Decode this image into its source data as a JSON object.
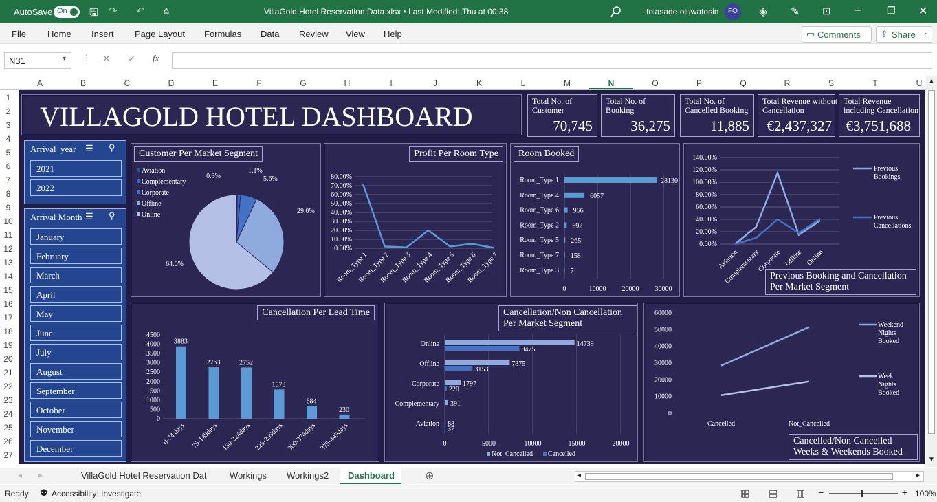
{
  "titlebar": {
    "autosave": "AutoSave",
    "toggle": "On",
    "filename": "VillaGold Hotel Reservation Data.xlsx  •  Last Modified: Thu at 00:38",
    "user": "folasade oluwatosin",
    "initials": "FO"
  },
  "menu": [
    "File",
    "Home",
    "Insert",
    "Page Layout",
    "Formulas",
    "Data",
    "Review",
    "View",
    "Help"
  ],
  "buttons": {
    "comments": "Comments",
    "share": "Share"
  },
  "formula": {
    "namebox": "N31",
    "fx": "fx",
    "value": ""
  },
  "columns": [
    "A",
    "B",
    "C",
    "D",
    "E",
    "F",
    "G",
    "H",
    "I",
    "J",
    "K",
    "L",
    "M",
    "N",
    "O",
    "P",
    "Q",
    "R",
    "S",
    "T",
    "U"
  ],
  "rows": [
    "1",
    "2",
    "3",
    "4",
    "5",
    "6",
    "7",
    "8",
    "9",
    "10",
    "11",
    "12",
    "13",
    "14",
    "15",
    "16",
    "17",
    "18",
    "19",
    "20",
    "21",
    "22",
    "23",
    "24",
    "25",
    "26",
    "27"
  ],
  "dashboard": {
    "title": "VILLAGOLD HOTEL DASHBOARD",
    "kpis": [
      {
        "label": "Total No. of Customer",
        "value": "70,745"
      },
      {
        "label": "Total No. of Booking",
        "value": "36,275"
      },
      {
        "label": "Total No. of Cancelled Booking",
        "value": "11,885"
      },
      {
        "label": "Total Revenue without Cancellation",
        "value": "€2,437,327"
      },
      {
        "label": "Total Revenue including Cancellation",
        "value": "€3,751,688"
      }
    ],
    "slicers": {
      "year": {
        "title": "Arrival_year",
        "items": [
          "2021",
          "2022"
        ]
      },
      "month": {
        "title": "Arrival Month",
        "items": [
          "January",
          "February",
          "March",
          "April",
          "May",
          "June",
          "July",
          "August",
          "September",
          "October",
          "November",
          "December"
        ]
      }
    },
    "panels": {
      "pie": "Customer Per Market Segment",
      "profit": "Profit Per Room Type",
      "rooms": "Room Booked",
      "prev": "Previous Booking and Cancellation Per Market Segment",
      "lead": "Cancellation Per Lead Time",
      "cancelseg": "Cancellation/Non Cancellation Per Market Segment",
      "weeks": "Cancelled/Non Cancelled Weeks & Weekends Booked"
    }
  },
  "chart_data": [
    {
      "type": "pie",
      "title": "Customer Per Market Segment",
      "categories": [
        "Aviation",
        "Complementary",
        "Corporate",
        "Offline",
        "Online"
      ],
      "values": [
        0.3,
        1.1,
        5.6,
        29.0,
        64.0
      ],
      "labels": [
        "0.3%",
        "1.1%",
        "5.6%",
        "29.0%",
        "64.0%"
      ],
      "colors": [
        "#2f5597",
        "#3a64c8",
        "#4472c4",
        "#8faadc",
        "#b4c0e6"
      ]
    },
    {
      "type": "line",
      "title": "Profit Per Room Type",
      "categories": [
        "Room_Type 1",
        "Room_Type 2",
        "Room_Type 3",
        "Room_Type 4",
        "Room_Type 5",
        "Room_Type 6",
        "Room_Type 7"
      ],
      "values": [
        72,
        2,
        1,
        20,
        2,
        5,
        0.5
      ],
      "yticks": [
        "80.00%",
        "70.00%",
        "60.00%",
        "50.00%",
        "40.00%",
        "30.00%",
        "20.00%",
        "10.00%",
        "0.00%"
      ],
      "ylim": [
        0,
        80
      ]
    },
    {
      "type": "bar",
      "title": "Room Booked",
      "categories": [
        "Room_Type 1",
        "Room_Type 4",
        "Room_Type 6",
        "Room_Type 2",
        "Room_Type 5",
        "Room_Type 7",
        "Room_Type 3"
      ],
      "values": [
        28130,
        6057,
        966,
        692,
        265,
        158,
        7
      ],
      "xticks": [
        "0",
        "10000",
        "20000",
        "30000"
      ],
      "xlim": [
        0,
        30000
      ]
    },
    {
      "type": "line",
      "title": "Previous Booking and Cancellation Per Market Segment",
      "categories": [
        "Aviation",
        "Complementary",
        "Corporate",
        "Offline",
        "Online"
      ],
      "series": [
        {
          "name": "Previous Bookings",
          "values": [
            0,
            28,
            115,
            15,
            38
          ]
        },
        {
          "name": "Previous Cancellations",
          "values": [
            0,
            10,
            40,
            18,
            41
          ]
        }
      ],
      "yticks": [
        "140.00%",
        "120.00%",
        "100.00%",
        "80.00%",
        "60.00%",
        "40.00%",
        "20.00%",
        "0.00%"
      ],
      "ylim": [
        0,
        140
      ]
    },
    {
      "type": "bar",
      "title": "Cancellation Per Lead Time",
      "categories": [
        "0-74 days",
        "75-149days",
        "150-224days",
        "225-299days",
        "300-374days",
        "375-449days"
      ],
      "values": [
        3883,
        2763,
        2752,
        1573,
        684,
        230
      ],
      "yticks": [
        "4500",
        "4000",
        "3500",
        "3000",
        "2500",
        "2000",
        "1500",
        "1000",
        "500",
        "0"
      ],
      "ylim": [
        0,
        4500
      ]
    },
    {
      "type": "bar",
      "title": "Cancellation/Non Cancellation Per Market Segment",
      "categories": [
        "Online",
        "Offline",
        "Corporate",
        "Complementary",
        "Aviation"
      ],
      "series": [
        {
          "name": "Not_Cancelled",
          "values": [
            14739,
            7375,
            1797,
            391,
            88
          ]
        },
        {
          "name": "Cancelled",
          "values": [
            8475,
            3153,
            220,
            0,
            37
          ]
        }
      ],
      "xticks": [
        "0",
        "5000",
        "10000",
        "15000",
        "20000"
      ],
      "xlim": [
        0,
        20000
      ]
    },
    {
      "type": "line",
      "title": "Cancelled/Non Cancelled Weeks & Weekends Booked",
      "categories": [
        "Cancelled",
        "Not_Cancelled"
      ],
      "series": [
        {
          "name": "Weekend Nights Booked",
          "values": [
            28500,
            51500
          ]
        },
        {
          "name": "Week Nights Booked",
          "values": [
            10800,
            19000
          ]
        }
      ],
      "yticks": [
        "60000",
        "50000",
        "40000",
        "30000",
        "20000",
        "10000",
        "0"
      ],
      "ylim": [
        0,
        60000
      ]
    }
  ],
  "sheets": [
    "VillaGold Hotel Reservation Dat",
    "Workings",
    "Workings2",
    "Dashboard"
  ],
  "status": {
    "ready": "Ready",
    "access": "Accessibility: Investigate",
    "zoom": "100%"
  }
}
